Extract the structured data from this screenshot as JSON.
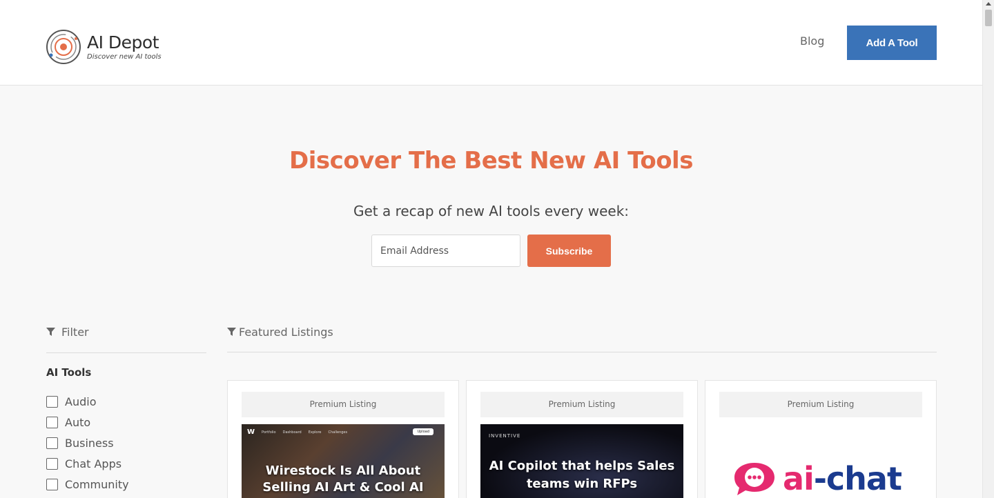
{
  "brand": {
    "name": "AI Depot",
    "tagline": "Discover new AI tools",
    "accent": "#e46e49",
    "primary": "#3a73b8"
  },
  "nav": {
    "blog": "Blog",
    "add_tool": "Add A Tool"
  },
  "hero": {
    "title": "Discover The Best New AI Tools",
    "subtitle": "Get a recap of new AI tools every week:",
    "email_placeholder": "Email Address",
    "subscribe": "Subscribe"
  },
  "filter": {
    "label": "Filter",
    "group_title": "AI Tools",
    "categories": [
      "Audio",
      "Auto",
      "Business",
      "Chat Apps",
      "Community"
    ]
  },
  "featured": {
    "label": "Featured Listings",
    "cards": [
      {
        "badge": "Premium Listing",
        "caption": "Wirestock Is All About Selling AI Art & Cool AI Features",
        "mini_nav": [
          "Portfolio",
          "Dashboard",
          "Explore",
          "Challenges"
        ],
        "mini_button": "Upload"
      },
      {
        "badge": "Premium Listing",
        "caption": "AI Copilot that helps Sales teams win RFPs",
        "tag": "INVENTIVE"
      },
      {
        "badge": "Premium Listing",
        "logo_text_a": "ai",
        "logo_text_b": "-chat"
      }
    ]
  },
  "icons": {
    "logo": "orbit-logo-icon",
    "filter": "funnel-icon",
    "chat": "chat-bubble-icon"
  }
}
